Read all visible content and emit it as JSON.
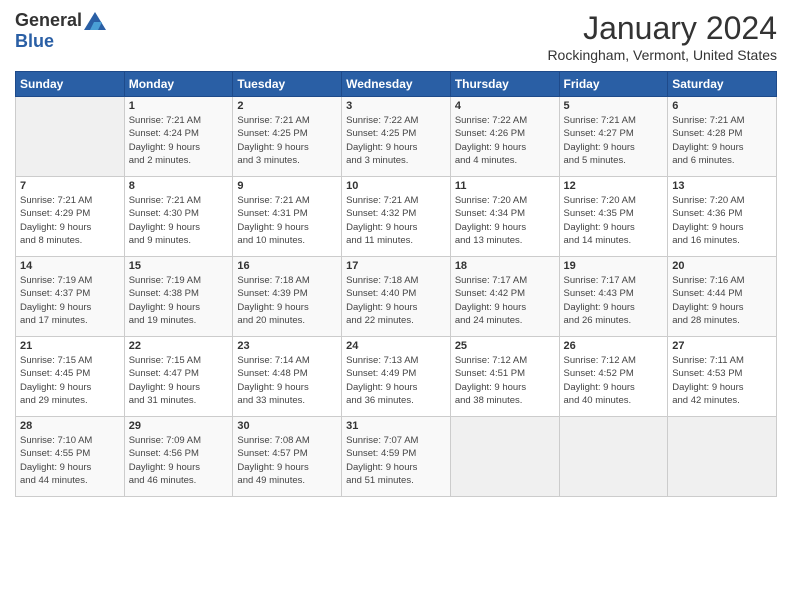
{
  "header": {
    "logo_general": "General",
    "logo_blue": "Blue",
    "month_title": "January 2024",
    "location": "Rockingham, Vermont, United States"
  },
  "days_of_week": [
    "Sunday",
    "Monday",
    "Tuesday",
    "Wednesday",
    "Thursday",
    "Friday",
    "Saturday"
  ],
  "weeks": [
    [
      {
        "day": "",
        "info": ""
      },
      {
        "day": "1",
        "info": "Sunrise: 7:21 AM\nSunset: 4:24 PM\nDaylight: 9 hours\nand 2 minutes."
      },
      {
        "day": "2",
        "info": "Sunrise: 7:21 AM\nSunset: 4:25 PM\nDaylight: 9 hours\nand 3 minutes."
      },
      {
        "day": "3",
        "info": "Sunrise: 7:22 AM\nSunset: 4:25 PM\nDaylight: 9 hours\nand 3 minutes."
      },
      {
        "day": "4",
        "info": "Sunrise: 7:22 AM\nSunset: 4:26 PM\nDaylight: 9 hours\nand 4 minutes."
      },
      {
        "day": "5",
        "info": "Sunrise: 7:21 AM\nSunset: 4:27 PM\nDaylight: 9 hours\nand 5 minutes."
      },
      {
        "day": "6",
        "info": "Sunrise: 7:21 AM\nSunset: 4:28 PM\nDaylight: 9 hours\nand 6 minutes."
      }
    ],
    [
      {
        "day": "7",
        "info": "Sunrise: 7:21 AM\nSunset: 4:29 PM\nDaylight: 9 hours\nand 8 minutes."
      },
      {
        "day": "8",
        "info": "Sunrise: 7:21 AM\nSunset: 4:30 PM\nDaylight: 9 hours\nand 9 minutes."
      },
      {
        "day": "9",
        "info": "Sunrise: 7:21 AM\nSunset: 4:31 PM\nDaylight: 9 hours\nand 10 minutes."
      },
      {
        "day": "10",
        "info": "Sunrise: 7:21 AM\nSunset: 4:32 PM\nDaylight: 9 hours\nand 11 minutes."
      },
      {
        "day": "11",
        "info": "Sunrise: 7:20 AM\nSunset: 4:34 PM\nDaylight: 9 hours\nand 13 minutes."
      },
      {
        "day": "12",
        "info": "Sunrise: 7:20 AM\nSunset: 4:35 PM\nDaylight: 9 hours\nand 14 minutes."
      },
      {
        "day": "13",
        "info": "Sunrise: 7:20 AM\nSunset: 4:36 PM\nDaylight: 9 hours\nand 16 minutes."
      }
    ],
    [
      {
        "day": "14",
        "info": "Sunrise: 7:19 AM\nSunset: 4:37 PM\nDaylight: 9 hours\nand 17 minutes."
      },
      {
        "day": "15",
        "info": "Sunrise: 7:19 AM\nSunset: 4:38 PM\nDaylight: 9 hours\nand 19 minutes."
      },
      {
        "day": "16",
        "info": "Sunrise: 7:18 AM\nSunset: 4:39 PM\nDaylight: 9 hours\nand 20 minutes."
      },
      {
        "day": "17",
        "info": "Sunrise: 7:18 AM\nSunset: 4:40 PM\nDaylight: 9 hours\nand 22 minutes."
      },
      {
        "day": "18",
        "info": "Sunrise: 7:17 AM\nSunset: 4:42 PM\nDaylight: 9 hours\nand 24 minutes."
      },
      {
        "day": "19",
        "info": "Sunrise: 7:17 AM\nSunset: 4:43 PM\nDaylight: 9 hours\nand 26 minutes."
      },
      {
        "day": "20",
        "info": "Sunrise: 7:16 AM\nSunset: 4:44 PM\nDaylight: 9 hours\nand 28 minutes."
      }
    ],
    [
      {
        "day": "21",
        "info": "Sunrise: 7:15 AM\nSunset: 4:45 PM\nDaylight: 9 hours\nand 29 minutes."
      },
      {
        "day": "22",
        "info": "Sunrise: 7:15 AM\nSunset: 4:47 PM\nDaylight: 9 hours\nand 31 minutes."
      },
      {
        "day": "23",
        "info": "Sunrise: 7:14 AM\nSunset: 4:48 PM\nDaylight: 9 hours\nand 33 minutes."
      },
      {
        "day": "24",
        "info": "Sunrise: 7:13 AM\nSunset: 4:49 PM\nDaylight: 9 hours\nand 36 minutes."
      },
      {
        "day": "25",
        "info": "Sunrise: 7:12 AM\nSunset: 4:51 PM\nDaylight: 9 hours\nand 38 minutes."
      },
      {
        "day": "26",
        "info": "Sunrise: 7:12 AM\nSunset: 4:52 PM\nDaylight: 9 hours\nand 40 minutes."
      },
      {
        "day": "27",
        "info": "Sunrise: 7:11 AM\nSunset: 4:53 PM\nDaylight: 9 hours\nand 42 minutes."
      }
    ],
    [
      {
        "day": "28",
        "info": "Sunrise: 7:10 AM\nSunset: 4:55 PM\nDaylight: 9 hours\nand 44 minutes."
      },
      {
        "day": "29",
        "info": "Sunrise: 7:09 AM\nSunset: 4:56 PM\nDaylight: 9 hours\nand 46 minutes."
      },
      {
        "day": "30",
        "info": "Sunrise: 7:08 AM\nSunset: 4:57 PM\nDaylight: 9 hours\nand 49 minutes."
      },
      {
        "day": "31",
        "info": "Sunrise: 7:07 AM\nSunset: 4:59 PM\nDaylight: 9 hours\nand 51 minutes."
      },
      {
        "day": "",
        "info": ""
      },
      {
        "day": "",
        "info": ""
      },
      {
        "day": "",
        "info": ""
      }
    ]
  ]
}
